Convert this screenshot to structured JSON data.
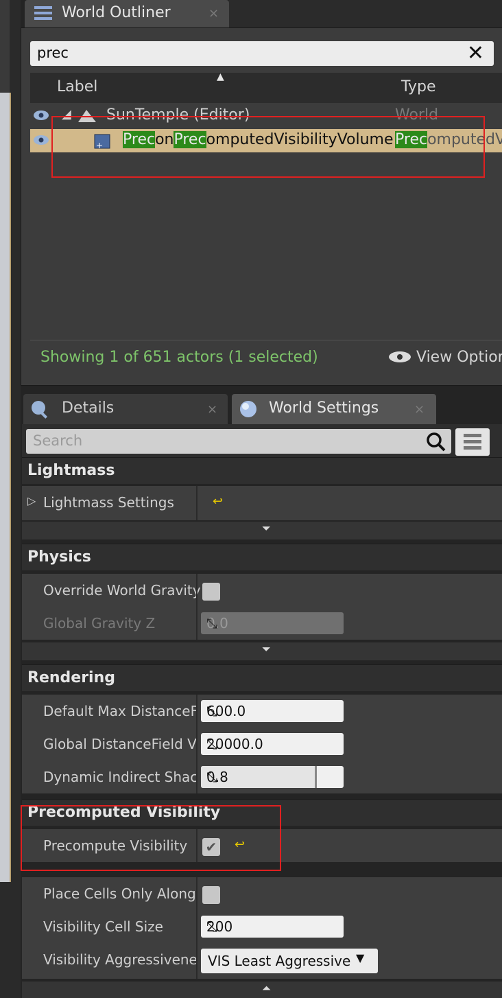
{
  "outliner": {
    "tab_title": "World Outliner",
    "tab_close": "×",
    "search_value": "prec",
    "clear_glyph": "✕",
    "columns": {
      "label": "Label",
      "type": "Type"
    },
    "rows": [
      {
        "name": "SunTemple (Editor)",
        "type": "World"
      },
      {
        "name_parts": [
          "Prec",
          "on",
          "Prec",
          "omputedVisibilityVolume"
        ],
        "type_parts": [
          "Prec",
          "omputedV"
        ]
      }
    ],
    "status": "Showing 1 of 651 actors (1 selected)",
    "view_options": "View Option"
  },
  "details": {
    "tabs": [
      {
        "label": "Details",
        "close": "×"
      },
      {
        "label": "World Settings",
        "close": "×"
      }
    ],
    "search_placeholder": "Search",
    "categories": {
      "lightmass": "Lightmass",
      "physics": "Physics",
      "rendering": "Rendering",
      "precomputed": "Precomputed Visibility"
    },
    "props": {
      "lightmass_settings": "Lightmass Settings",
      "override_world_gravity": "Override World Gravity",
      "global_gravity_z": "Global Gravity Z",
      "global_gravity_z_value": "0.0",
      "default_max_distance": "Default Max DistanceF",
      "default_max_distance_value": "600.0",
      "global_distancefield": "Global DistanceField V",
      "global_distancefield_value": "20000.0",
      "dynamic_indirect": "Dynamic Indirect Shac",
      "dynamic_indirect_value": "0.8",
      "precompute_visibility": "Precompute Visibility",
      "place_cells": "Place Cells Only Along",
      "visibility_cell_size": "Visibility Cell Size",
      "visibility_cell_size_value": "200",
      "visibility_aggressiveness": "Visibility Aggressivene",
      "visibility_aggressiveness_value": "VIS Least Aggressive"
    },
    "icons": {
      "reset": "reset-to-default-icon",
      "spin": "spin-arrows-icon",
      "checkmark": "✔"
    }
  },
  "colors": {
    "highlight": "#2c8a1a",
    "selected_row": "#d2b98a",
    "annotation": "#e02020",
    "status_text": "#7ec46a"
  }
}
